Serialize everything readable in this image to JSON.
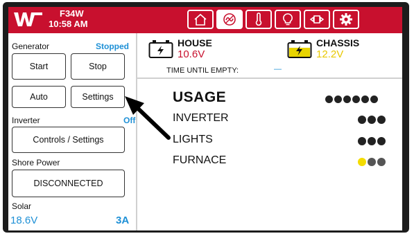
{
  "header": {
    "model": "F34W",
    "time": "10:58 AM",
    "tabs": [
      {
        "icon": "home-icon",
        "active": false
      },
      {
        "icon": "generator-icon",
        "active": true
      },
      {
        "icon": "thermometer-icon",
        "active": false
      },
      {
        "icon": "lightbulb-icon",
        "active": false
      },
      {
        "icon": "slide-out-icon",
        "active": false
      },
      {
        "icon": "gear-icon",
        "active": false
      }
    ],
    "accent_color": "#c8102e"
  },
  "generator": {
    "label": "Generator",
    "status": "Stopped",
    "start_label": "Start",
    "stop_label": "Stop",
    "auto_label": "Auto",
    "settings_label": "Settings"
  },
  "inverter": {
    "label": "Inverter",
    "status": "Off",
    "controls_label": "Controls / Settings"
  },
  "shore_power": {
    "label": "Shore Power",
    "status_label": "DISCONNECTED"
  },
  "solar": {
    "label": "Solar",
    "voltage": "18.6V",
    "current": "3A"
  },
  "batteries": {
    "house": {
      "name": "HOUSE",
      "voltage": "10.6V",
      "color": "#c8102e"
    },
    "chassis": {
      "name": "CHASSIS",
      "voltage": "12.2V",
      "color": "#e8c800"
    },
    "time_until_empty_label": "TIME UNTIL EMPTY:",
    "time_until_empty_value": "—"
  },
  "usage": {
    "title": "USAGE",
    "title_level": 6,
    "rows": [
      {
        "label": "INVERTER",
        "level": 3
      },
      {
        "label": "LIGHTS",
        "level": 3
      },
      {
        "label": "FURNACE",
        "level": 3,
        "first_dot_color": "#f4dc00"
      }
    ]
  },
  "status_colors": {
    "info": "#1e90d6"
  }
}
